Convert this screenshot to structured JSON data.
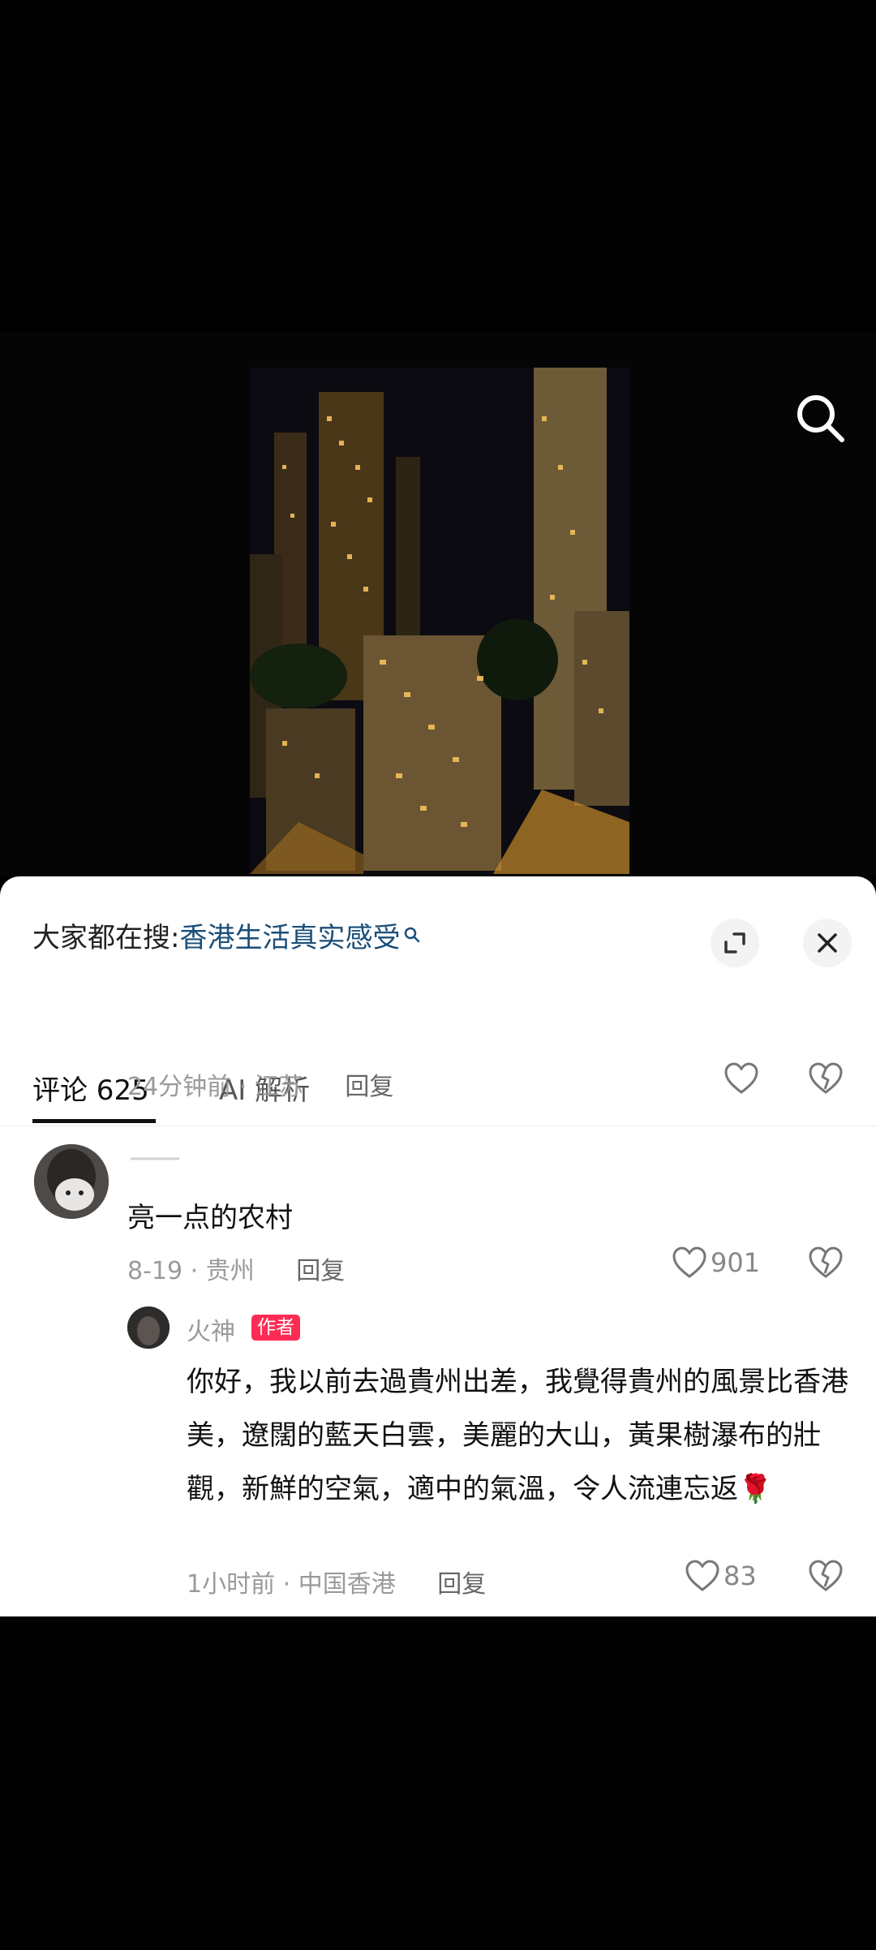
{
  "hot_search": {
    "prefix": "大家都在搜:",
    "keyword": "香港生活真实感受"
  },
  "tabs": [
    {
      "label": "评论 625",
      "active": true
    },
    {
      "label": "AI 解析",
      "active": false
    }
  ],
  "comments": [
    {
      "time_location": "24分钟前 · 江苏",
      "reply_label": "回复"
    },
    {
      "text": "亮一点的农村",
      "time_location": "8-19 · 贵州",
      "reply_label": "回复",
      "likes": "901",
      "replies": [
        {
          "user": "火神",
          "badge": "作者",
          "text": "你好，我以前去過貴州出差，我覺得貴州的風景比香港美，遼闊的藍天白雲，美麗的大山，黃果樹瀑布的壯觀，新鮮的空氣，適中的氣溫，令人流連忘返🌹",
          "time_location": "1小时前 · 中国香港",
          "reply_label": "回复",
          "likes": "83"
        }
      ]
    }
  ],
  "icons": {
    "search": "search-icon",
    "expand": "expand-icon",
    "close": "close-icon",
    "like": "heart-icon",
    "dislike": "broken-heart-icon"
  },
  "colors": {
    "keyword": "#1b4f7a",
    "author_badge": "#fe2c55"
  }
}
